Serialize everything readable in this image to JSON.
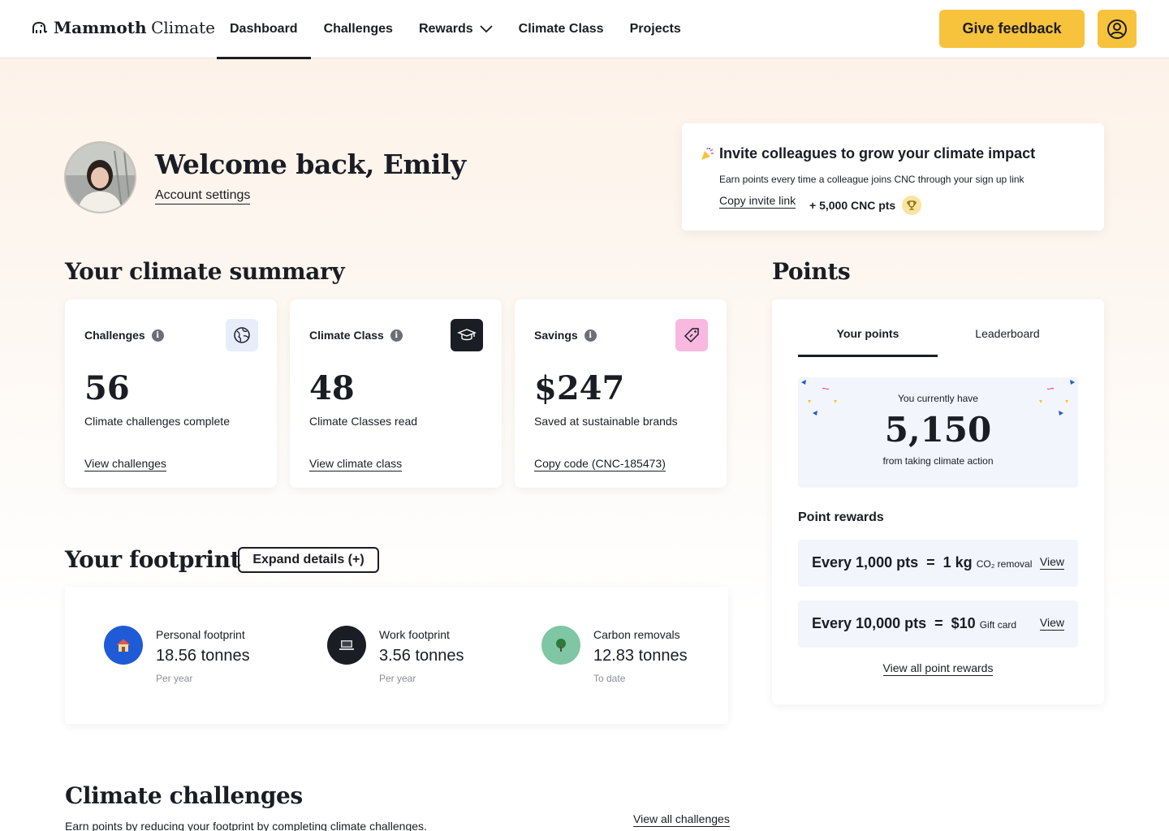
{
  "header": {
    "logo_bold": "Mammoth",
    "logo_light": "Climate",
    "nav": [
      "Dashboard",
      "Challenges",
      "Rewards",
      "Climate Class",
      "Projects"
    ],
    "feedback_label": "Give feedback"
  },
  "welcome": {
    "title": "Welcome back, Emily",
    "account_link": "Account settings"
  },
  "invite": {
    "title": "Invite colleagues to grow your climate impact",
    "subtitle": "Earn points every time a colleague joins CNC through your sign up link",
    "link": "Copy invite link",
    "points": "+ 5,000 CNC pts"
  },
  "summary": {
    "heading": "Your climate summary",
    "cards": [
      {
        "label": "Challenges",
        "value": "56",
        "desc": "Climate challenges complete",
        "link": "View challenges",
        "icon_bg": "#e7edfb"
      },
      {
        "label": "Climate Class",
        "value": "48",
        "desc": "Climate Classes read",
        "link": "View climate class",
        "icon_bg": "#1b1d24"
      },
      {
        "label": "Savings",
        "value": "$247",
        "desc": "Saved at sustainable brands",
        "link": "Copy code (CNC-185473)",
        "icon_bg": "#f8b8e0"
      }
    ]
  },
  "footprint": {
    "heading": "Your footprint",
    "expand_label": "Expand details (+)",
    "items": [
      {
        "label": "Personal footprint",
        "value": "18.56 tonnes",
        "note": "Per year",
        "color": "#1f5bd6"
      },
      {
        "label": "Work footprint",
        "value": "3.56 tonnes",
        "note": "Per year",
        "color": "#1b1d24"
      },
      {
        "label": "Carbon removals",
        "value": "12.83 tonnes",
        "note": "To date",
        "color": "#7fc6a4"
      }
    ]
  },
  "points": {
    "heading": "Points",
    "tabs": [
      "Your points",
      "Leaderboard"
    ],
    "balance_top": "You currently have",
    "balance_value": "5,150",
    "balance_bottom": "from taking climate action",
    "rewards_heading": "Point rewards",
    "rewards": [
      {
        "left": "Every 1,000 pts",
        "eq": "=",
        "right": "1 kg",
        "unit": "CO₂ removal",
        "view": "View"
      },
      {
        "left": "Every 10,000 pts",
        "eq": "=",
        "right": "$10",
        "unit": "Gift card",
        "view": "View"
      }
    ],
    "all_rewards": "View all point rewards"
  },
  "challenges": {
    "heading": "Climate challenges",
    "subtitle": "Earn points by reducing your footprint by completing climate challenges.",
    "view_all": "View all challenges"
  },
  "colors": {
    "accent": "#f7c23c",
    "text": "#1b1d24",
    "panel": "#f2f5fb"
  }
}
